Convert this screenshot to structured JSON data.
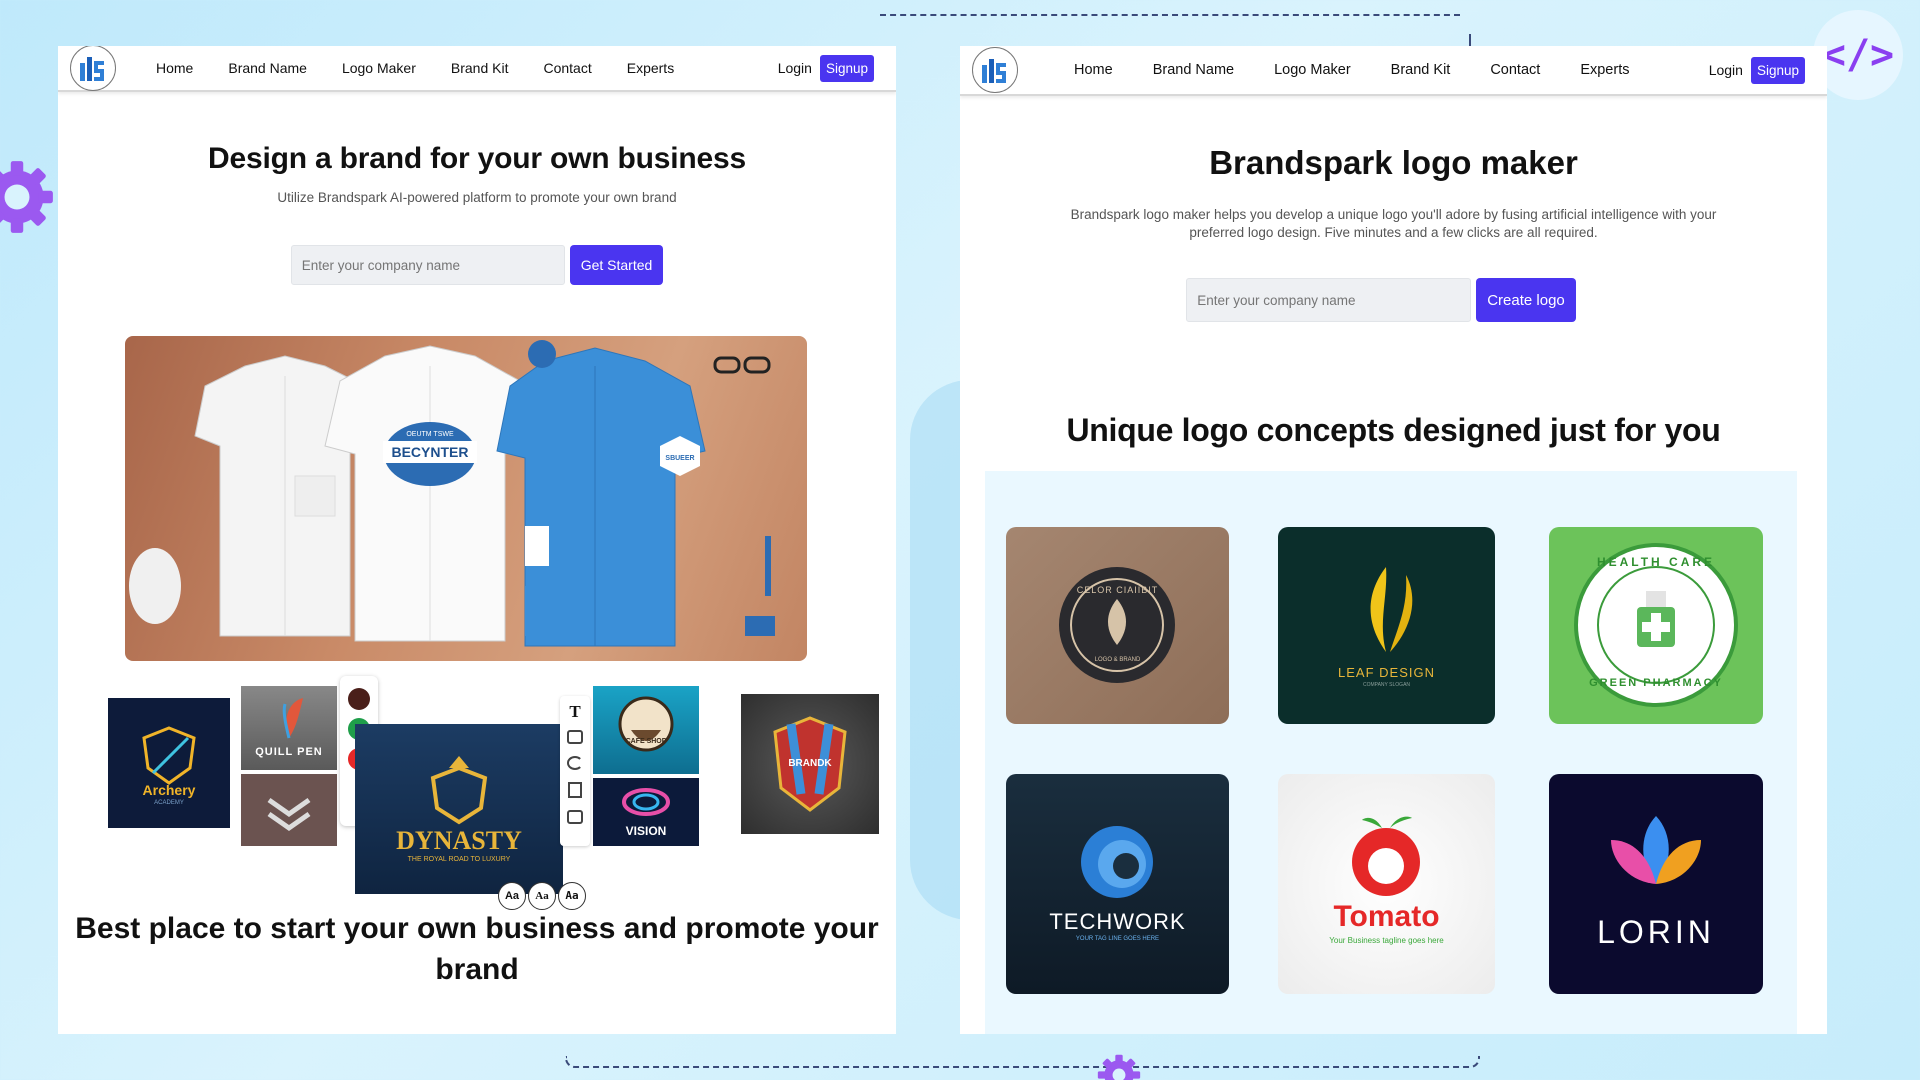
{
  "decor": {
    "code_badge": "</>"
  },
  "left_panel": {
    "nav": {
      "links": [
        "Home",
        "Brand Name",
        "Logo Maker",
        "Brand Kit",
        "Contact",
        "Experts"
      ],
      "login": "Login",
      "signup": "Signup"
    },
    "hero": {
      "title": "Design a brand for your own business",
      "subtitle": "Utilize Brandspark AI-powered platform to promote your own brand",
      "input_placeholder": "Enter your company name",
      "cta": "Get Started"
    },
    "mockup_text": {
      "shirt_logo_top": "OEUTM TSWE",
      "shirt_logo": "BECYNTER",
      "blue_shirt_logo": "SBUEER"
    },
    "collage": {
      "archery": "Archery",
      "archery_sub": "ACADEMY",
      "quill": "QUILL PEN",
      "dynasty": "DYNASTY",
      "dynasty_sub": "THE ROYAL ROAD TO LUXURY",
      "cafe": "CAFE SHOP",
      "vision": "VISION",
      "brand": "BRANDK",
      "font_sample": "Aa",
      "tool_text": "T"
    },
    "bottom_title": "Best place to start your own business and promote your brand"
  },
  "right_panel": {
    "nav": {
      "links": [
        "Home",
        "Brand Name",
        "Logo Maker",
        "Brand Kit",
        "Contact",
        "Experts"
      ],
      "login": "Login",
      "signup": "Signup"
    },
    "title": "Brandspark logo maker",
    "subtitle": "Brandspark logo maker helps you develop a unique logo you'll adore by fusing artificial intelligence with your preferred logo design. Five minutes and a few clicks are all required.",
    "input_placeholder": "Enter your company name",
    "cta": "Create logo",
    "concepts_title": "Unique logo concepts designed just for you",
    "concepts": [
      {
        "name": "CELOR CIAIIBIT",
        "sub": "LOGO & BRAND"
      },
      {
        "name": "LEAF DESIGN",
        "sub": "COMPANY SLOGAN"
      },
      {
        "name": "HEALTH CARE",
        "sub": "GREEN PHARMACY"
      },
      {
        "name": "TECHWORK",
        "sub": "YOUR TAG LINE GOES HERE"
      },
      {
        "name": "Tomato",
        "sub": "Your Business tagline goes here"
      },
      {
        "name": "LORIN",
        "sub": ""
      }
    ]
  },
  "colors": {
    "accent": "#4a35f0",
    "code_purple": "#8a3ff0"
  }
}
